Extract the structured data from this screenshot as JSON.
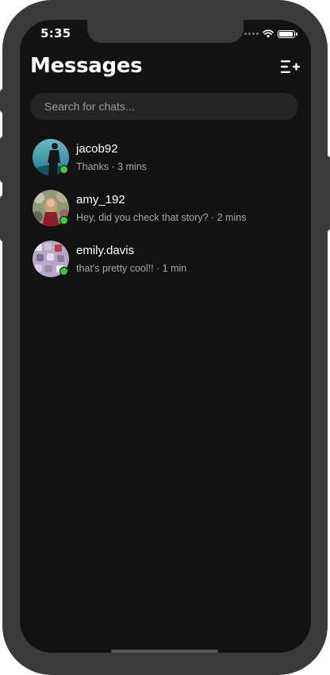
{
  "status_bar": {
    "time": "5:35"
  },
  "header": {
    "title": "Messages",
    "compose_icon": "new-message-icon"
  },
  "search": {
    "placeholder": "Search for chats..."
  },
  "chats": [
    {
      "name": "jacob92",
      "preview": "Thanks · 3 mins",
      "online": true
    },
    {
      "name": "amy_192",
      "preview": "Hey, did you check that story? · 2 mins",
      "online": true
    },
    {
      "name": "emily.davis",
      "preview": "that's pretty cool!! · 1 min",
      "online": true
    }
  ],
  "colors": {
    "background": "#121212",
    "online": "#3ec74a",
    "search_bg": "#242424"
  }
}
